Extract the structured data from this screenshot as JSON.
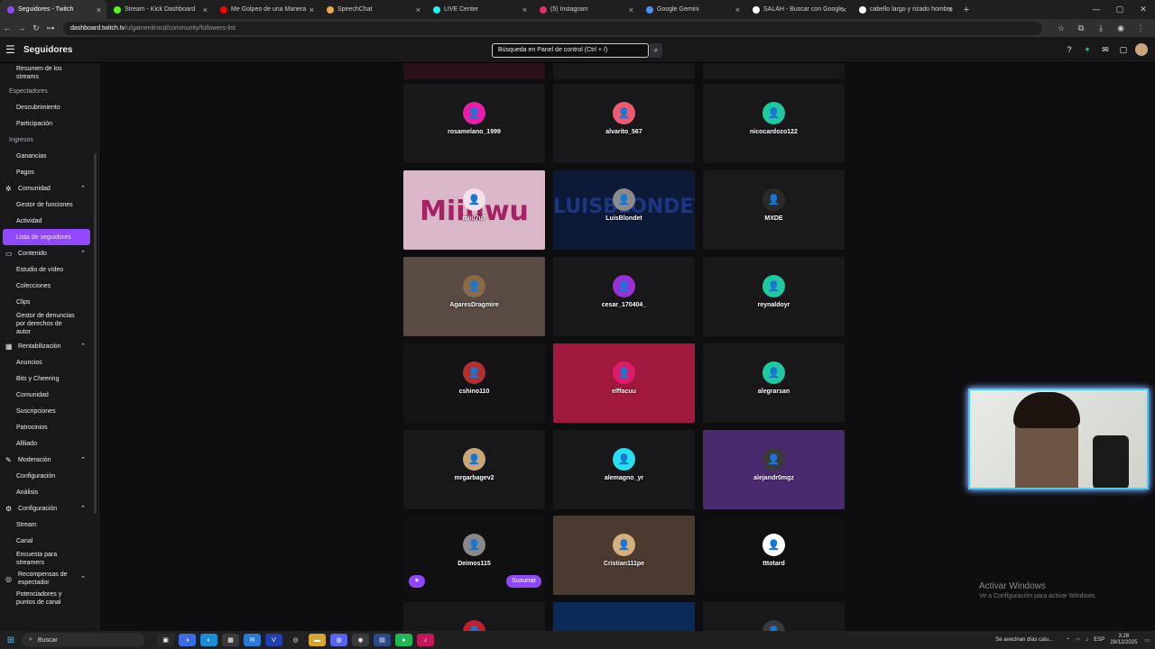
{
  "browser": {
    "tabs": [
      {
        "label": "Seguidores - Twitch",
        "color": "#9147ff",
        "active": true
      },
      {
        "label": "Stream - Kick Dashboard",
        "color": "#53fc18",
        "active": false
      },
      {
        "label": "Me Golpeo de una Manera",
        "color": "#ff0000",
        "active": false
      },
      {
        "label": "SpeechChat",
        "color": "#f4a64b",
        "active": false
      },
      {
        "label": "LIVE Center",
        "color": "#25f4ee",
        "active": false
      },
      {
        "label": "(5) Instagram",
        "color": "#e1306c",
        "active": false
      },
      {
        "label": "Google Gemini",
        "color": "#4b8ef5",
        "active": false
      },
      {
        "label": "SALAH - Buscar con Google",
        "color": "#ffffff",
        "active": false
      },
      {
        "label": "cabello largo y rizado hombre",
        "color": "#ffffff",
        "active": false
      }
    ],
    "url_host": "dashboard.twitch.tv",
    "url_path": "/u/gamenitrocd/community/followers-list"
  },
  "header": {
    "title": "Seguidores",
    "search_placeholder": "Búsqueda en Panel de control (Ctrl + /)"
  },
  "sidebar": {
    "items": [
      {
        "kind": "sub",
        "label": "Resumen de los\nstreams"
      },
      {
        "kind": "grp",
        "label": "Espectadores"
      },
      {
        "kind": "sub",
        "label": "Descubrimiento"
      },
      {
        "kind": "sub",
        "label": "Participación"
      },
      {
        "kind": "grp",
        "label": "Ingresos"
      },
      {
        "kind": "sub",
        "label": "Ganancias"
      },
      {
        "kind": "sub",
        "label": "Pagos"
      },
      {
        "kind": "sec",
        "label": "Comunidad",
        "icon": "✲"
      },
      {
        "kind": "sub",
        "label": "Gestor de funciones"
      },
      {
        "kind": "sub",
        "label": "Actividad"
      },
      {
        "kind": "active",
        "label": "Lista de seguidores"
      },
      {
        "kind": "sec",
        "label": "Contenido",
        "icon": "▭"
      },
      {
        "kind": "sub",
        "label": "Estudio de vídeo"
      },
      {
        "kind": "sub",
        "label": "Colecciones"
      },
      {
        "kind": "sub",
        "label": "Clips"
      },
      {
        "kind": "sub",
        "label": "Gestor de denuncias\npor derechos de\nautor"
      },
      {
        "kind": "sec",
        "label": "Rentabilización",
        "icon": "▦"
      },
      {
        "kind": "sub",
        "label": "Anuncios"
      },
      {
        "kind": "sub",
        "label": "Bits y Cheering"
      },
      {
        "kind": "sub",
        "label": "Comunidad"
      },
      {
        "kind": "sub",
        "label": "Suscripciones"
      },
      {
        "kind": "sub",
        "label": "Patrocinios"
      },
      {
        "kind": "sub",
        "label": "Afiliado"
      },
      {
        "kind": "sec",
        "label": "Moderación",
        "icon": "✎"
      },
      {
        "kind": "sub",
        "label": "Configuración"
      },
      {
        "kind": "sub",
        "label": "Análisis"
      },
      {
        "kind": "sec",
        "label": "Configuración",
        "icon": "⚙"
      },
      {
        "kind": "sub",
        "label": "Stream"
      },
      {
        "kind": "sub",
        "label": "Canal"
      },
      {
        "kind": "sub",
        "label": "Encuesta para\nstreamers"
      },
      {
        "kind": "sec",
        "label": "Recompensas de\nespectador",
        "icon": "◎"
      },
      {
        "kind": "sub",
        "label": "Potenciadores y\npuntos de canal"
      }
    ]
  },
  "followers": [
    {
      "name": "",
      "bg": "#2a1016",
      "avatar": "none"
    },
    {
      "name": "",
      "bg": "#18181b",
      "avatar": "none"
    },
    {
      "name": "",
      "bg": "#18181b",
      "avatar": "none"
    },
    {
      "name": "rosamelano_1999",
      "bg": "#18181b",
      "avatar": "#e91ea8"
    },
    {
      "name": "alvarito_567",
      "bg": "#18181b",
      "avatar": "#ef5a6f"
    },
    {
      "name": "nicocardozo122",
      "bg": "#18181b",
      "avatar": "#1fc9a0"
    },
    {
      "name": "miiu7u7",
      "bg": "#d9b6c8",
      "avatar": "#f5e1ea",
      "banner_text": "Miiuwu"
    },
    {
      "name": "LuisBlondet",
      "bg": "#0c1a38",
      "avatar": "#8a8a8a",
      "banner_text": "LUISBLONDET"
    },
    {
      "name": "MXDE",
      "bg": "#1a1a1a",
      "avatar": "#2a2a2a"
    },
    {
      "name": "AgaresDragmire",
      "bg": "#5a4a44",
      "avatar": "#8a6a4a"
    },
    {
      "name": "cesar_170404_",
      "bg": "#18181b",
      "avatar": "#9b2fd8"
    },
    {
      "name": "reynaldoyr",
      "bg": "#18181b",
      "avatar": "#1fc9a0"
    },
    {
      "name": "cshino110",
      "bg": "#151316",
      "avatar": "#b33030"
    },
    {
      "name": "elffacuu",
      "bg": "#a0193c",
      "avatar": "#e01a6a"
    },
    {
      "name": "alegrarsan",
      "bg": "#18181b",
      "avatar": "#1fc9a0"
    },
    {
      "name": "mrgarbagev2",
      "bg": "#18181b",
      "avatar": "#c9a779"
    },
    {
      "name": "alemagno_yr",
      "bg": "#18181b",
      "avatar": "#25e0f0"
    },
    {
      "name": "alejandr0mgz",
      "bg": "#4a2a6e",
      "avatar": "#3a3a3a"
    },
    {
      "name": "Deimos115",
      "bg": "#101010",
      "avatar": "#888888"
    },
    {
      "name": "Cristian111pe",
      "bg": "#4a3a30",
      "avatar": "#d5b07a"
    },
    {
      "name": "tttotard",
      "bg": "#0f0f0f",
      "avatar": "#ffffff"
    },
    {
      "name": "",
      "bg": "#18181b",
      "avatar": "#c02030"
    },
    {
      "name": "",
      "bg": "#0c2a58",
      "avatar": "none"
    },
    {
      "name": "",
      "bg": "#18181b",
      "avatar": "#3a3a3a"
    }
  ],
  "card_actions": {
    "whisper_label": "Susurrar"
  },
  "overlay": {
    "activate_title": "Activar Windows",
    "activate_sub": "Ve a Configuración para activar Windows."
  },
  "taskbar": {
    "search_label": "Buscar",
    "weather_text": "Se avecinan días calu...",
    "lang": "ESP",
    "time": "3:28",
    "date": "28/12/2025"
  }
}
